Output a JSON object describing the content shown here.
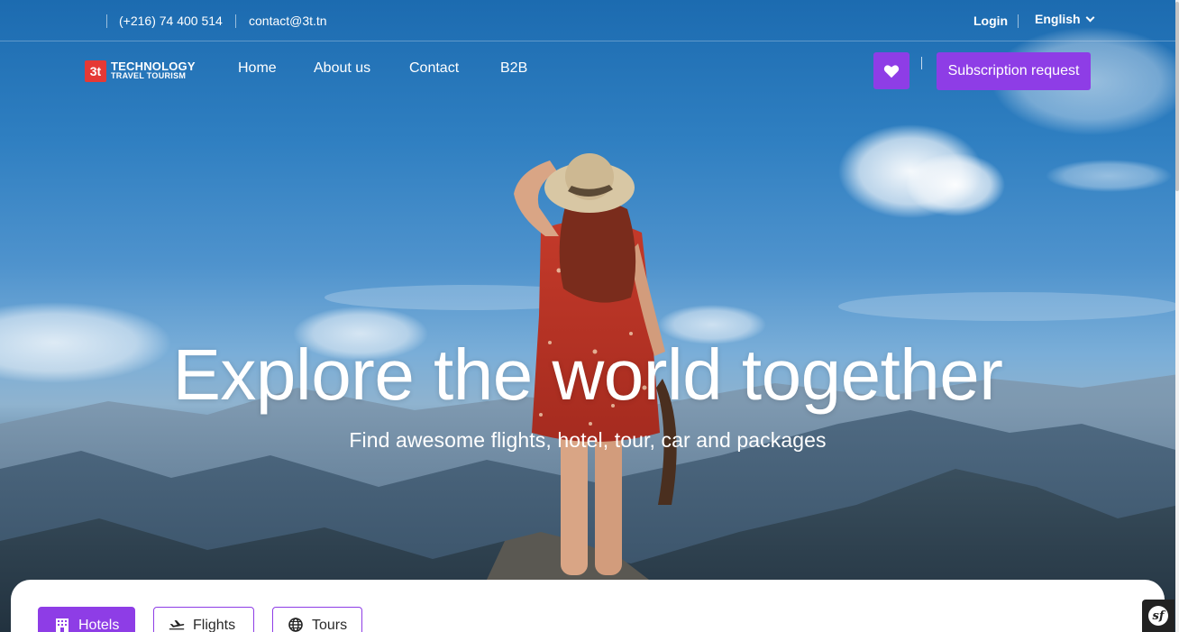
{
  "topbar": {
    "phone": "(+216) 74 400 514",
    "email": "contact@3t.tn",
    "login": "Login",
    "language": "English"
  },
  "logo": {
    "line1": "TECHNOLOGY",
    "line2": "TRAVEL TOURISM",
    "mark": "3t"
  },
  "nav": {
    "items": [
      "Home",
      "About us",
      "Contact",
      "B2B"
    ],
    "subscription": "Subscription request"
  },
  "hero": {
    "title": "Explore the world together",
    "subtitle": "Find awesome flights, hotel, tour, car and packages"
  },
  "search": {
    "tabs": [
      {
        "label": "Hotels",
        "icon": "hotel-icon",
        "active": true
      },
      {
        "label": "Flights",
        "icon": "plane-icon",
        "active": false
      },
      {
        "label": "Tours",
        "icon": "globe-icon",
        "active": false
      }
    ]
  },
  "colors": {
    "accent": "#8e3de6",
    "logo_red": "#e53935"
  }
}
